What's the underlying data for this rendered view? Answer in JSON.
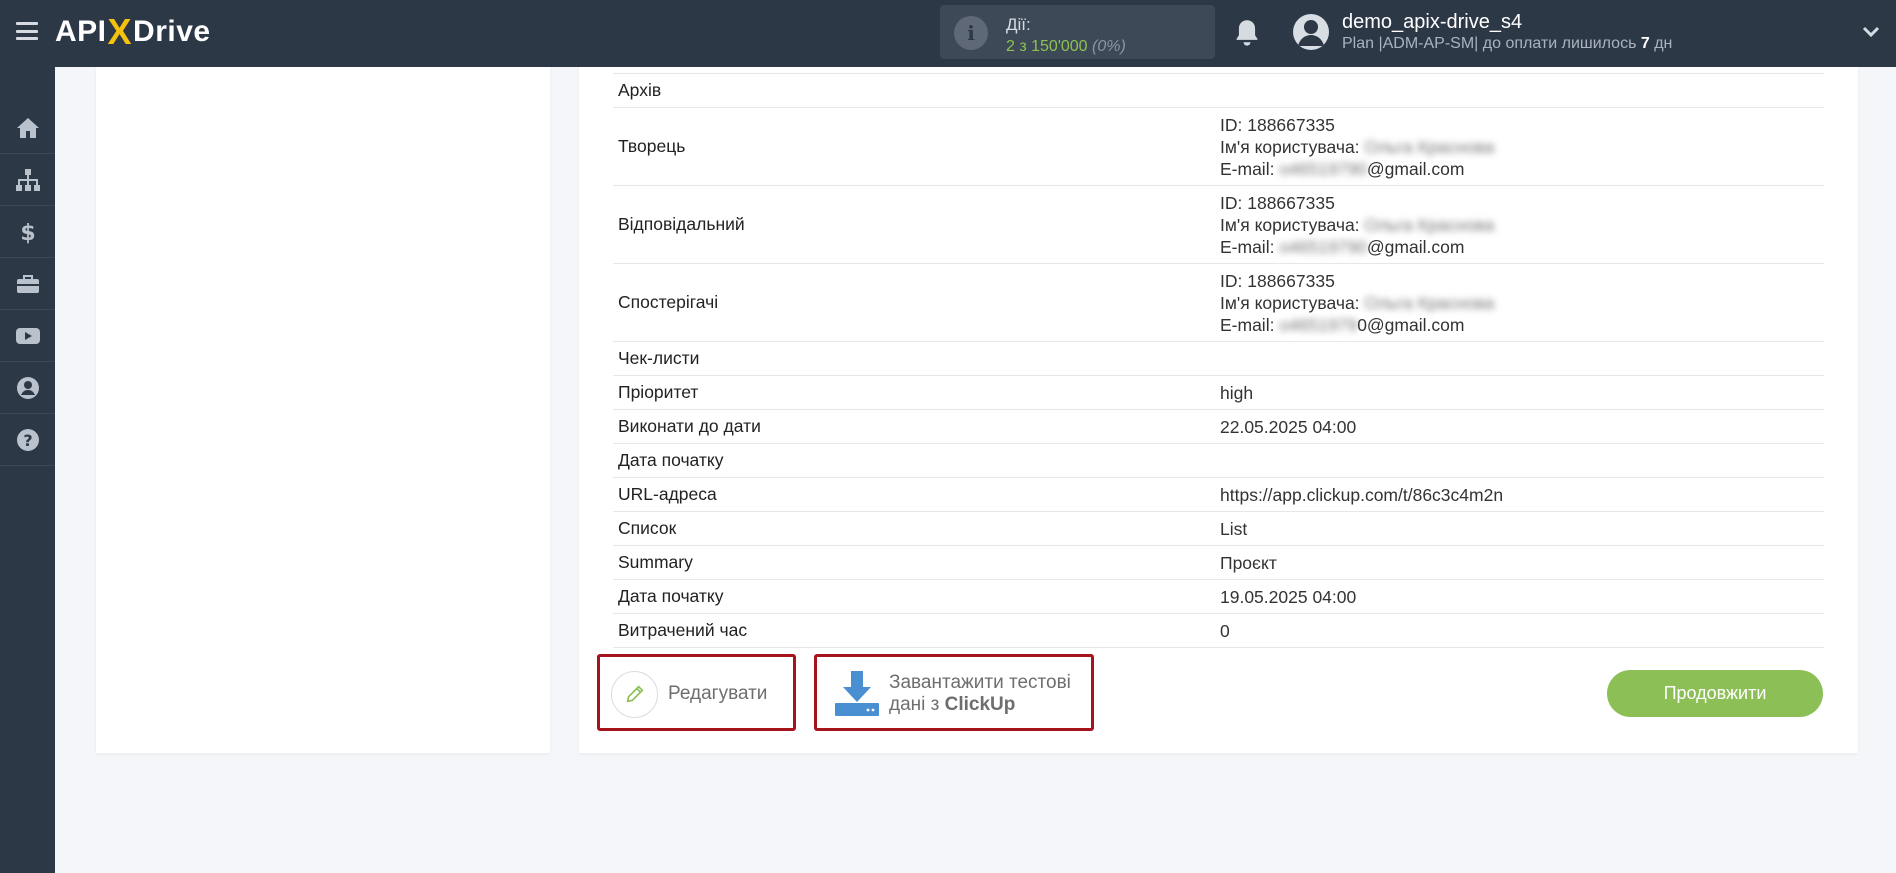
{
  "header": {
    "logo_left": "API",
    "logo_x": "X",
    "logo_right": "Drive",
    "actions_label": "Дії:",
    "actions_count": "2 з 150'000",
    "actions_percent": "(0%)",
    "user_name": "demo_apix-drive_s4",
    "plan_prefix": "Plan |ADM-AP-SM| до оплати лишилось ",
    "plan_days": "7",
    "plan_suffix": " дн"
  },
  "sidebar": {
    "items": [
      "home-icon",
      "sitemap-icon",
      "dollar-icon",
      "briefcase-icon",
      "youtube-icon",
      "user-circle-icon",
      "help-icon"
    ]
  },
  "table": {
    "archive_label": "Архів",
    "creator": {
      "label": "Творець",
      "id": "ID: 188667335",
      "username_label": "Ім'я користувача: ",
      "username": "Ольга Краснова",
      "email_label": "E-mail: ",
      "email_hidden": "o46519790",
      "email_domain": "@gmail.com"
    },
    "responsible": {
      "label": "Відповідальний",
      "id": "ID: 188667335",
      "username_label": "Ім'я користувача: ",
      "username": "Ольга Краснова",
      "email_label": "E-mail: ",
      "email_hidden": "o46519790",
      "email_domain": "@gmail.com"
    },
    "watchers": {
      "label": "Спостерігачі",
      "id": "ID: 188667335",
      "username_label": "Ім'я користувача: ",
      "username": "Ольга Краснова",
      "email_label": "E-mail: ",
      "email_hidden": "o4651979",
      "email_domain": "0@gmail.com"
    },
    "checklists_label": "Чек-листи",
    "priority": {
      "label": "Пріоритет",
      "value": "high"
    },
    "due_date": {
      "label": "Виконати до дати",
      "value": "22.05.2025 04:00"
    },
    "start_date_1": {
      "label": "Дата початку",
      "value": ""
    },
    "url": {
      "label": "URL-адреса",
      "value": "https://app.clickup.com/t/86c3c4m2n"
    },
    "list": {
      "label": "Список",
      "value": "List"
    },
    "summary": {
      "label": "Summary",
      "value": "Проєкт"
    },
    "start_date_2": {
      "label": "Дата початку",
      "value": "19.05.2025 04:00"
    },
    "time_spent": {
      "label": "Витрачений час",
      "value": "0"
    }
  },
  "buttons": {
    "edit_label": "Редагувати",
    "load_line1": "Завантажити тестові",
    "load_line2_prefix": "дані з ",
    "load_line2_service": "ClickUp",
    "continue_label": "Продовжити"
  },
  "colors": {
    "topbar": "#2d3846",
    "accent_green": "#8cbf56",
    "highlight_red": "#a7131d",
    "download_blue": "#4a8fd1"
  }
}
